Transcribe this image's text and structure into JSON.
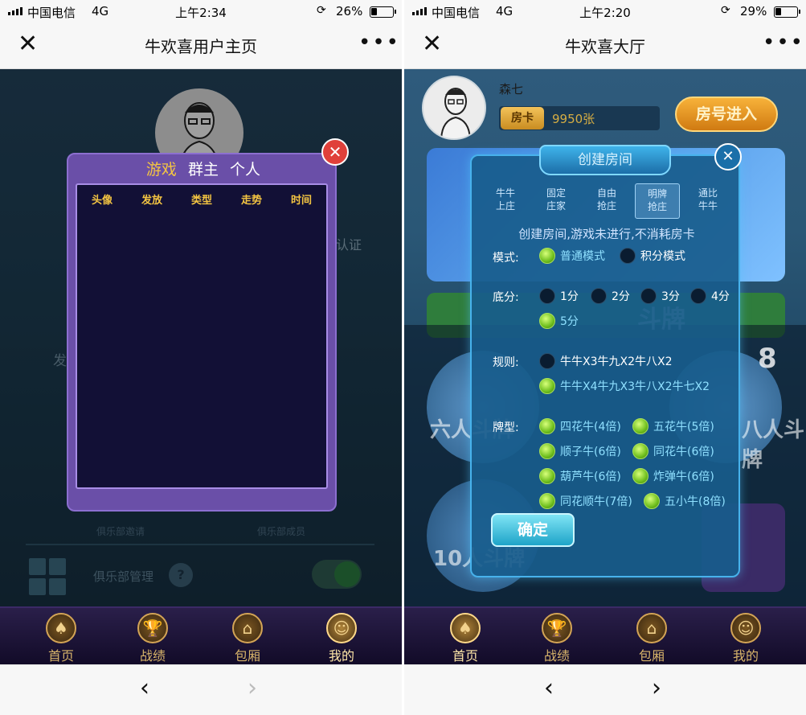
{
  "left": {
    "status": {
      "carrier": "中国电信",
      "network": "4G",
      "time": "上午2:34",
      "battery": "26%",
      "battery_level": 0.26
    },
    "nav": {
      "close": "✕",
      "title": "牛欢喜用户主页",
      "more": "•••"
    },
    "background": {
      "cert": "认证",
      "fa": "发",
      "invite": "俱乐部邀请",
      "members": "俱乐部成员",
      "manage": "俱乐部管理",
      "help": "?"
    },
    "modal": {
      "tabs": [
        "游戏",
        "群主",
        "个人"
      ],
      "active_tab": 0,
      "columns": [
        "头像",
        "发放",
        "类型",
        "走势",
        "时间"
      ],
      "close": "✕"
    },
    "tabbar": [
      {
        "label": "首页",
        "icon": "♠"
      },
      {
        "label": "战绩",
        "icon": "🏆"
      },
      {
        "label": "包厢",
        "icon": "⌂"
      },
      {
        "label": "我的",
        "icon": "☺"
      }
    ],
    "active_tab_index": 3,
    "browser": {
      "back": "‹",
      "forward": "›"
    }
  },
  "right": {
    "status": {
      "carrier": "中国电信",
      "network": "4G",
      "time": "上午2:20",
      "battery": "29%",
      "battery_level": 0.29
    },
    "nav": {
      "close": "✕",
      "title": "牛欢喜大厅",
      "more": "•••"
    },
    "profile": {
      "name": "森七",
      "card_tag": "房卡",
      "card_count": "9950张",
      "enter_button": "房号进入"
    },
    "bg_text": {
      "game1": "六人斗牌",
      "game2": "八人斗牌",
      "game3": "十人斗牌",
      "game4": "10人斗牌",
      "banner": "斗牌",
      "num": "8"
    },
    "modal": {
      "title": "创建房间",
      "close": "✕",
      "tabs": [
        {
          "line1": "牛牛",
          "line2": "上庄"
        },
        {
          "line1": "固定",
          "line2": "庄家"
        },
        {
          "line1": "自由",
          "line2": "抢庄"
        },
        {
          "line1": "明牌",
          "line2": "抢庄"
        },
        {
          "line1": "通比",
          "line2": "牛牛"
        }
      ],
      "active_tab": 3,
      "notice": "创建房间,游戏未进行,不消耗房卡",
      "mode_label": "模式:",
      "mode_options": [
        {
          "text": "普通模式",
          "on": true
        },
        {
          "text": "积分模式",
          "on": false
        }
      ],
      "base_label": "底分:",
      "base_options": [
        {
          "text": "1分",
          "on": false
        },
        {
          "text": "2分",
          "on": false
        },
        {
          "text": "3分",
          "on": false
        },
        {
          "text": "4分",
          "on": false
        },
        {
          "text": "5分",
          "on": true
        }
      ],
      "rule_label": "规则:",
      "rule_options": [
        {
          "text": "牛牛X3牛九X2牛八X2",
          "on": false
        },
        {
          "text": "牛牛X4牛九X3牛八X2牛七X2",
          "on": true
        }
      ],
      "type_label": "牌型:",
      "type_options": [
        {
          "text": "四花牛(4倍)",
          "on": true
        },
        {
          "text": "五花牛(5倍)",
          "on": true
        },
        {
          "text": "顺子牛(6倍)",
          "on": true
        },
        {
          "text": "同花牛(6倍)",
          "on": true
        },
        {
          "text": "葫芦牛(6倍)",
          "on": true
        },
        {
          "text": "炸弹牛(6倍)",
          "on": true
        },
        {
          "text": "同花顺牛(7倍)",
          "on": true
        },
        {
          "text": "五小牛(8倍)",
          "on": true
        }
      ],
      "confirm": "确定"
    },
    "tabbar": [
      {
        "label": "首页",
        "icon": "♠"
      },
      {
        "label": "战绩",
        "icon": "🏆"
      },
      {
        "label": "包厢",
        "icon": "⌂"
      },
      {
        "label": "我的",
        "icon": "☺"
      }
    ],
    "active_tab_index": 0,
    "browser": {
      "back": "‹",
      "forward": "›"
    }
  }
}
